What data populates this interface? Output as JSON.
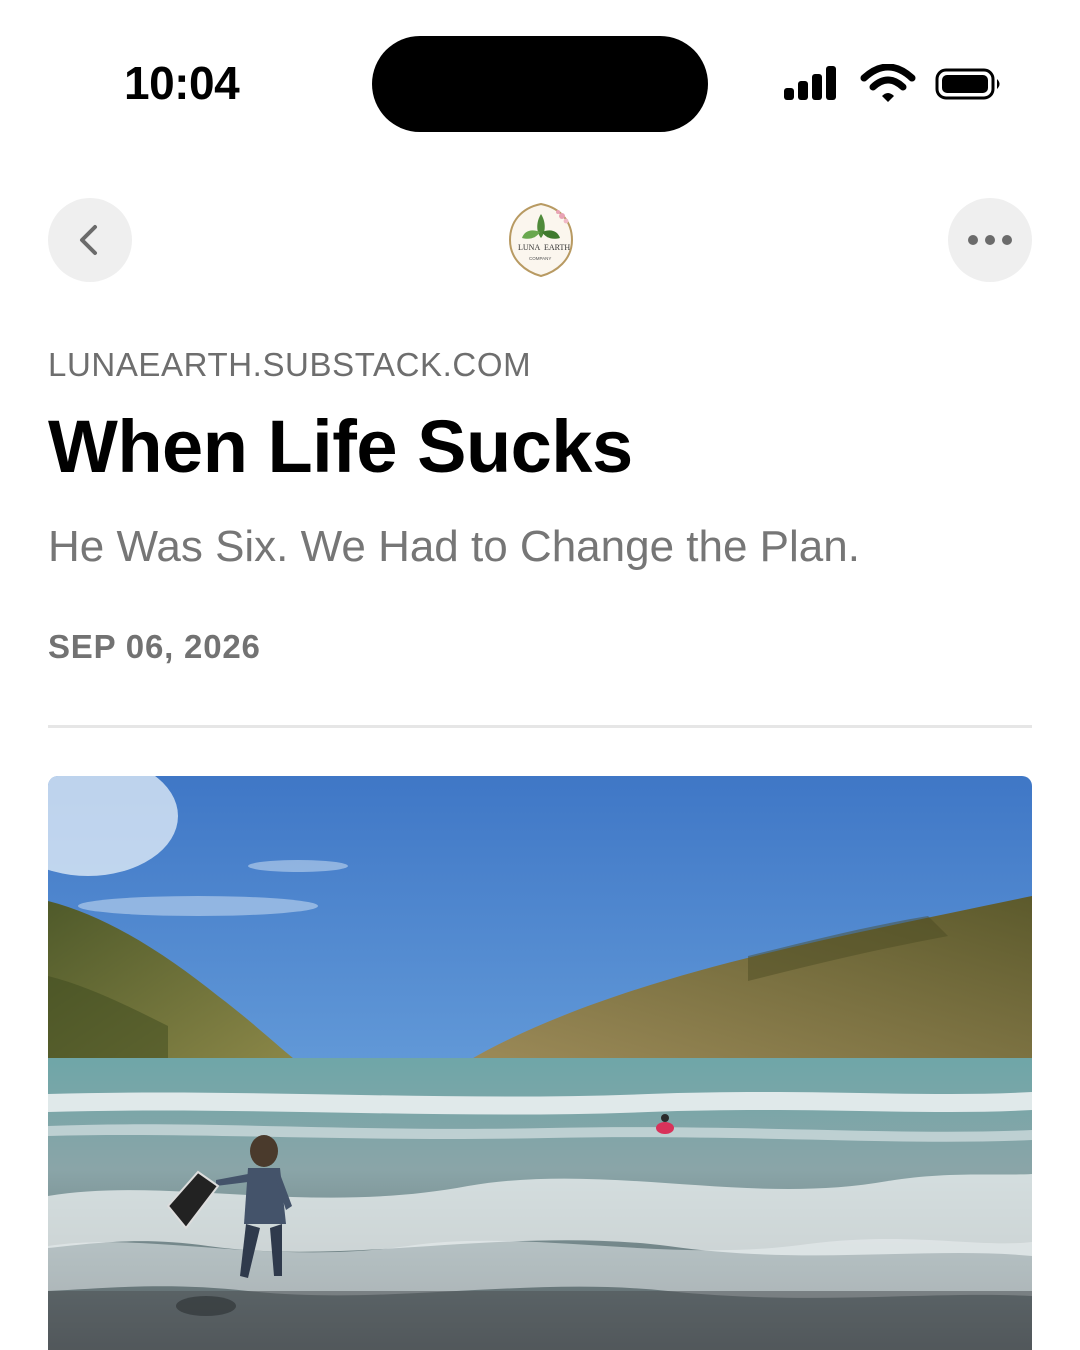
{
  "status_bar": {
    "time": "10:04"
  },
  "nav": {
    "back_icon": "chevron-left-icon",
    "more_icon": "ellipsis-icon"
  },
  "logo": {
    "text_top": "LUNA",
    "text_right": "EARTH",
    "text_bottom": "COMPANY"
  },
  "article": {
    "publication": "LUNAEARTH.SUBSTACK.COM",
    "title": "When Life Sucks",
    "subtitle": "He Was Six. We Had to Change the Plan.",
    "date": "SEP 06, 2026"
  },
  "hero_image": {
    "description_icon": "beach-photo"
  },
  "colors": {
    "secondary_text": "#6e6e6e",
    "button_bg": "#efefef",
    "divider": "#e6e6e6"
  }
}
